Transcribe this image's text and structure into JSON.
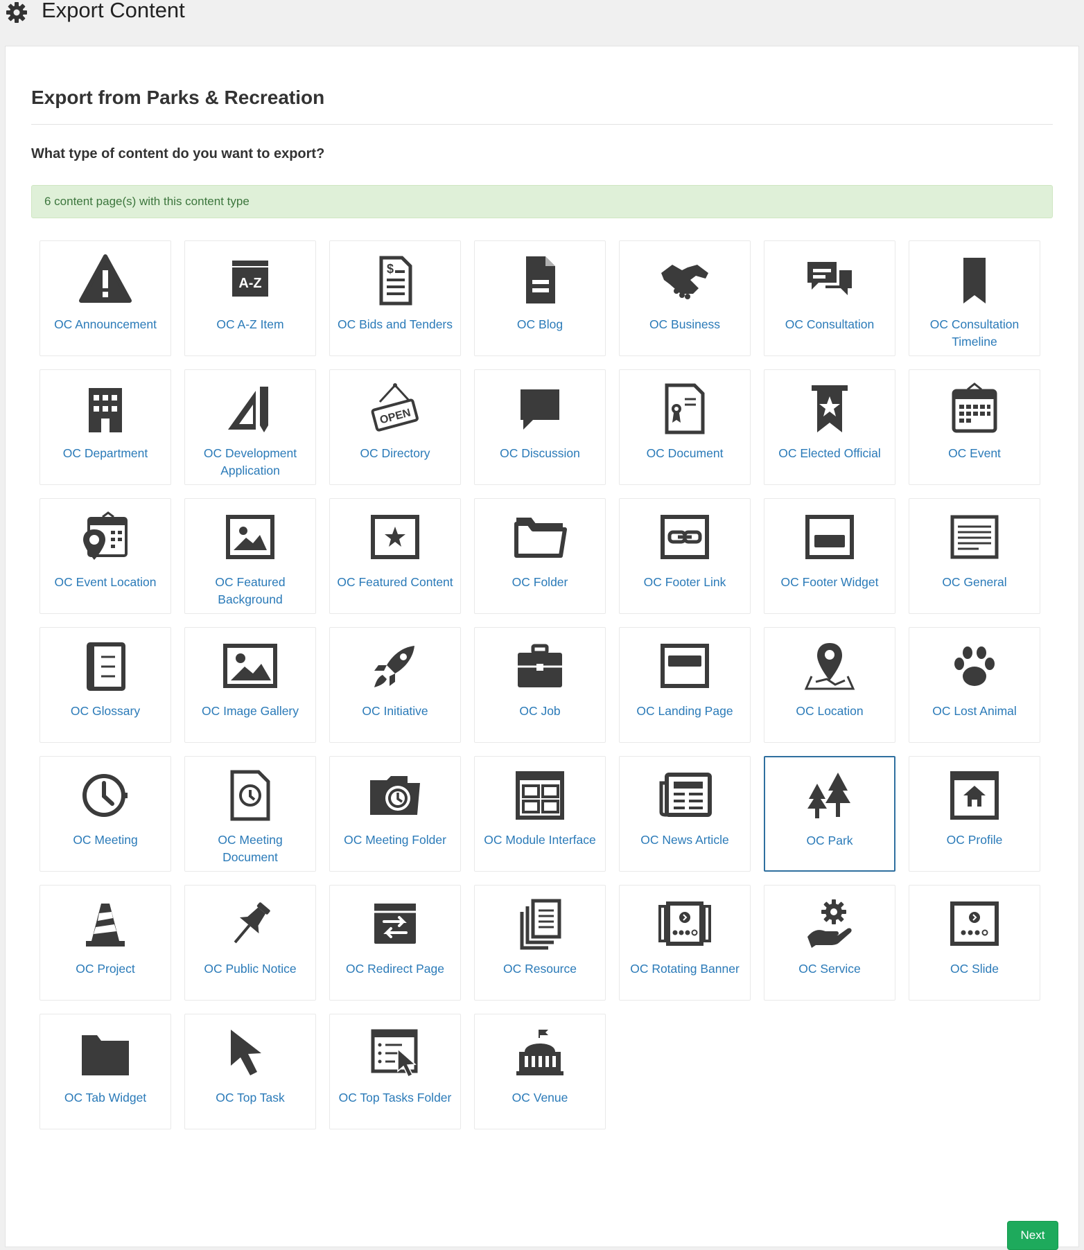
{
  "window": {
    "title": "Export Content"
  },
  "panel": {
    "heading": "Export from Parks & Recreation",
    "question": "What type of content do you want to export?",
    "alert": "6 content page(s) with this content type"
  },
  "content_types": [
    {
      "label": "OC Announcement",
      "icon": "warning-icon"
    },
    {
      "label": "OC A-Z Item",
      "icon": "a-z-icon"
    },
    {
      "label": "OC Bids and Tenders",
      "icon": "bid-document-icon"
    },
    {
      "label": "OC Blog",
      "icon": "blog-document-icon"
    },
    {
      "label": "OC Business",
      "icon": "handshake-icon"
    },
    {
      "label": "OC Consultation",
      "icon": "chat-bubbles-icon"
    },
    {
      "label": "OC Consultation Timeline",
      "icon": "bookmark-icon"
    },
    {
      "label": "OC Department",
      "icon": "building-icon"
    },
    {
      "label": "OC Development Application",
      "icon": "ruler-pencil-icon"
    },
    {
      "label": "OC Directory",
      "icon": "open-sign-icon"
    },
    {
      "label": "OC Discussion",
      "icon": "speech-bubble-icon"
    },
    {
      "label": "OC Document",
      "icon": "certificate-icon"
    },
    {
      "label": "OC Elected Official",
      "icon": "ribbon-star-icon"
    },
    {
      "label": "OC Event",
      "icon": "calendar-icon"
    },
    {
      "label": "OC Event Location",
      "icon": "calendar-pin-icon"
    },
    {
      "label": "OC Featured Background",
      "icon": "image-frame-icon"
    },
    {
      "label": "OC Featured Content",
      "icon": "star-frame-icon"
    },
    {
      "label": "OC Folder",
      "icon": "folder-outline-icon"
    },
    {
      "label": "OC Footer Link",
      "icon": "link-frame-icon"
    },
    {
      "label": "OC Footer Widget",
      "icon": "footer-widget-icon"
    },
    {
      "label": "OC General",
      "icon": "text-lines-icon"
    },
    {
      "label": "OC Glossary",
      "icon": "glossary-icon"
    },
    {
      "label": "OC Image Gallery",
      "icon": "gallery-icon"
    },
    {
      "label": "OC Initiative",
      "icon": "rocket-icon"
    },
    {
      "label": "OC Job",
      "icon": "briefcase-icon"
    },
    {
      "label": "OC Landing Page",
      "icon": "landing-page-icon"
    },
    {
      "label": "OC Location",
      "icon": "map-pin-icon"
    },
    {
      "label": "OC Lost Animal",
      "icon": "paw-icon"
    },
    {
      "label": "OC Meeting",
      "icon": "clock-icon"
    },
    {
      "label": "OC Meeting Document",
      "icon": "clock-document-icon"
    },
    {
      "label": "OC Meeting Folder",
      "icon": "clock-folder-icon"
    },
    {
      "label": "OC Module Interface",
      "icon": "modules-icon"
    },
    {
      "label": "OC News Article",
      "icon": "newspaper-icon"
    },
    {
      "label": "OC Park",
      "icon": "trees-icon",
      "selected": true
    },
    {
      "label": "OC Profile",
      "icon": "home-frame-icon"
    },
    {
      "label": "OC Project",
      "icon": "traffic-cone-icon"
    },
    {
      "label": "OC Public Notice",
      "icon": "pushpin-icon"
    },
    {
      "label": "OC Redirect Page",
      "icon": "redirect-icon"
    },
    {
      "label": "OC Resource",
      "icon": "stacked-documents-icon"
    },
    {
      "label": "OC Rotating Banner",
      "icon": "carousel-icon"
    },
    {
      "label": "OC Service",
      "icon": "gear-hand-icon"
    },
    {
      "label": "OC Slide",
      "icon": "slide-icon"
    },
    {
      "label": "OC Tab Widget",
      "icon": "folder-solid-icon"
    },
    {
      "label": "OC Top Task",
      "icon": "cursor-arrow-icon"
    },
    {
      "label": "OC Top Tasks Folder",
      "icon": "task-list-icon"
    },
    {
      "label": "OC Venue",
      "icon": "venue-icon"
    }
  ],
  "buttons": {
    "next": "Next"
  },
  "colors": {
    "link": "#2a7ab8",
    "icon": "#3b3b3b",
    "selected_border": "#2f6f9f",
    "alert_bg": "#dff0d8",
    "alert_text": "#3c763d",
    "next_button": "#1eaa5c"
  }
}
